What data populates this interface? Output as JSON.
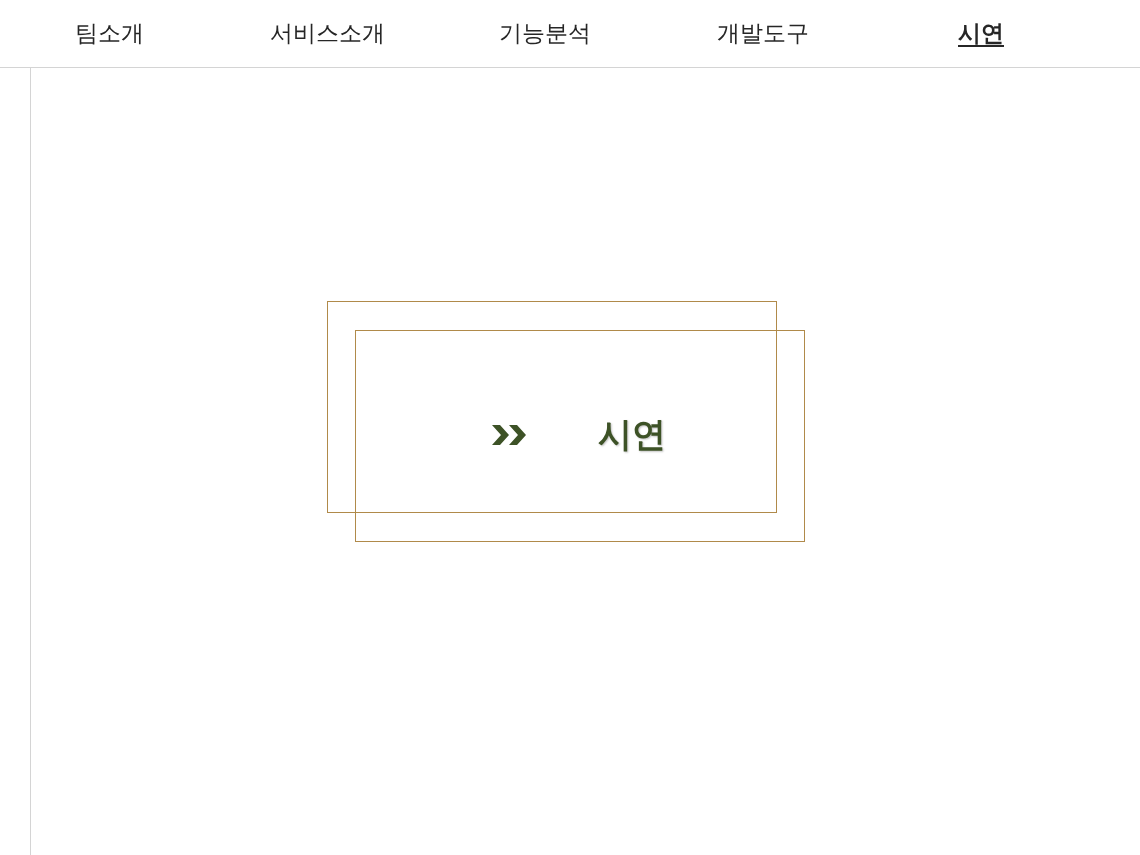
{
  "nav": {
    "tabs": [
      {
        "label": "팀소개",
        "selected": false
      },
      {
        "label": "서비스소개",
        "selected": false
      },
      {
        "label": "기능분석",
        "selected": false
      },
      {
        "label": "개발도구",
        "selected": false
      },
      {
        "label": "시연",
        "selected": true
      }
    ]
  },
  "title_card": {
    "title": "시연"
  }
}
